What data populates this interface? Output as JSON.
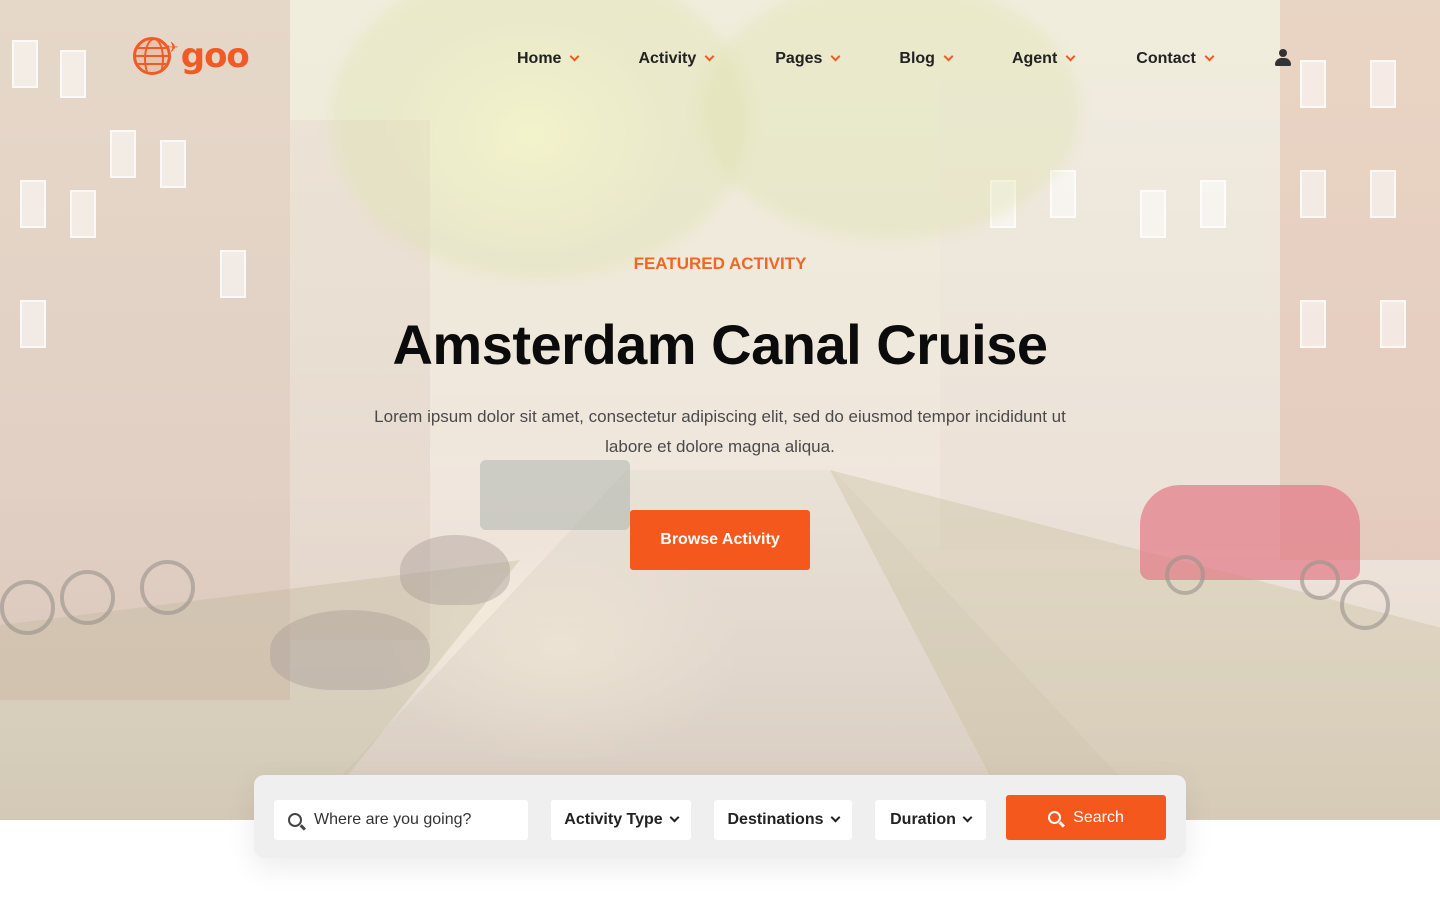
{
  "brand": {
    "logo_text": "goo",
    "accent_color": "#f4581d"
  },
  "nav": {
    "items": [
      {
        "label": "Home"
      },
      {
        "label": "Activity"
      },
      {
        "label": "Pages"
      },
      {
        "label": "Blog"
      },
      {
        "label": "Agent"
      },
      {
        "label": "Contact"
      }
    ],
    "user_icon": "user-icon"
  },
  "hero": {
    "eyebrow": "FEATURED ACTIVITY",
    "title": "Amsterdam Canal Cruise",
    "description": "Lorem ipsum dolor sit amet, consectetur adipiscing elit, sed do eiusmod tempor incididunt ut labore et dolore magna aliqua.",
    "cta_label": "Browse Activity"
  },
  "search": {
    "placeholder": "Where are you going?",
    "activity_type": "Activity Type",
    "destinations": "Destinations",
    "duration": "Duration",
    "button_label": "Search"
  }
}
